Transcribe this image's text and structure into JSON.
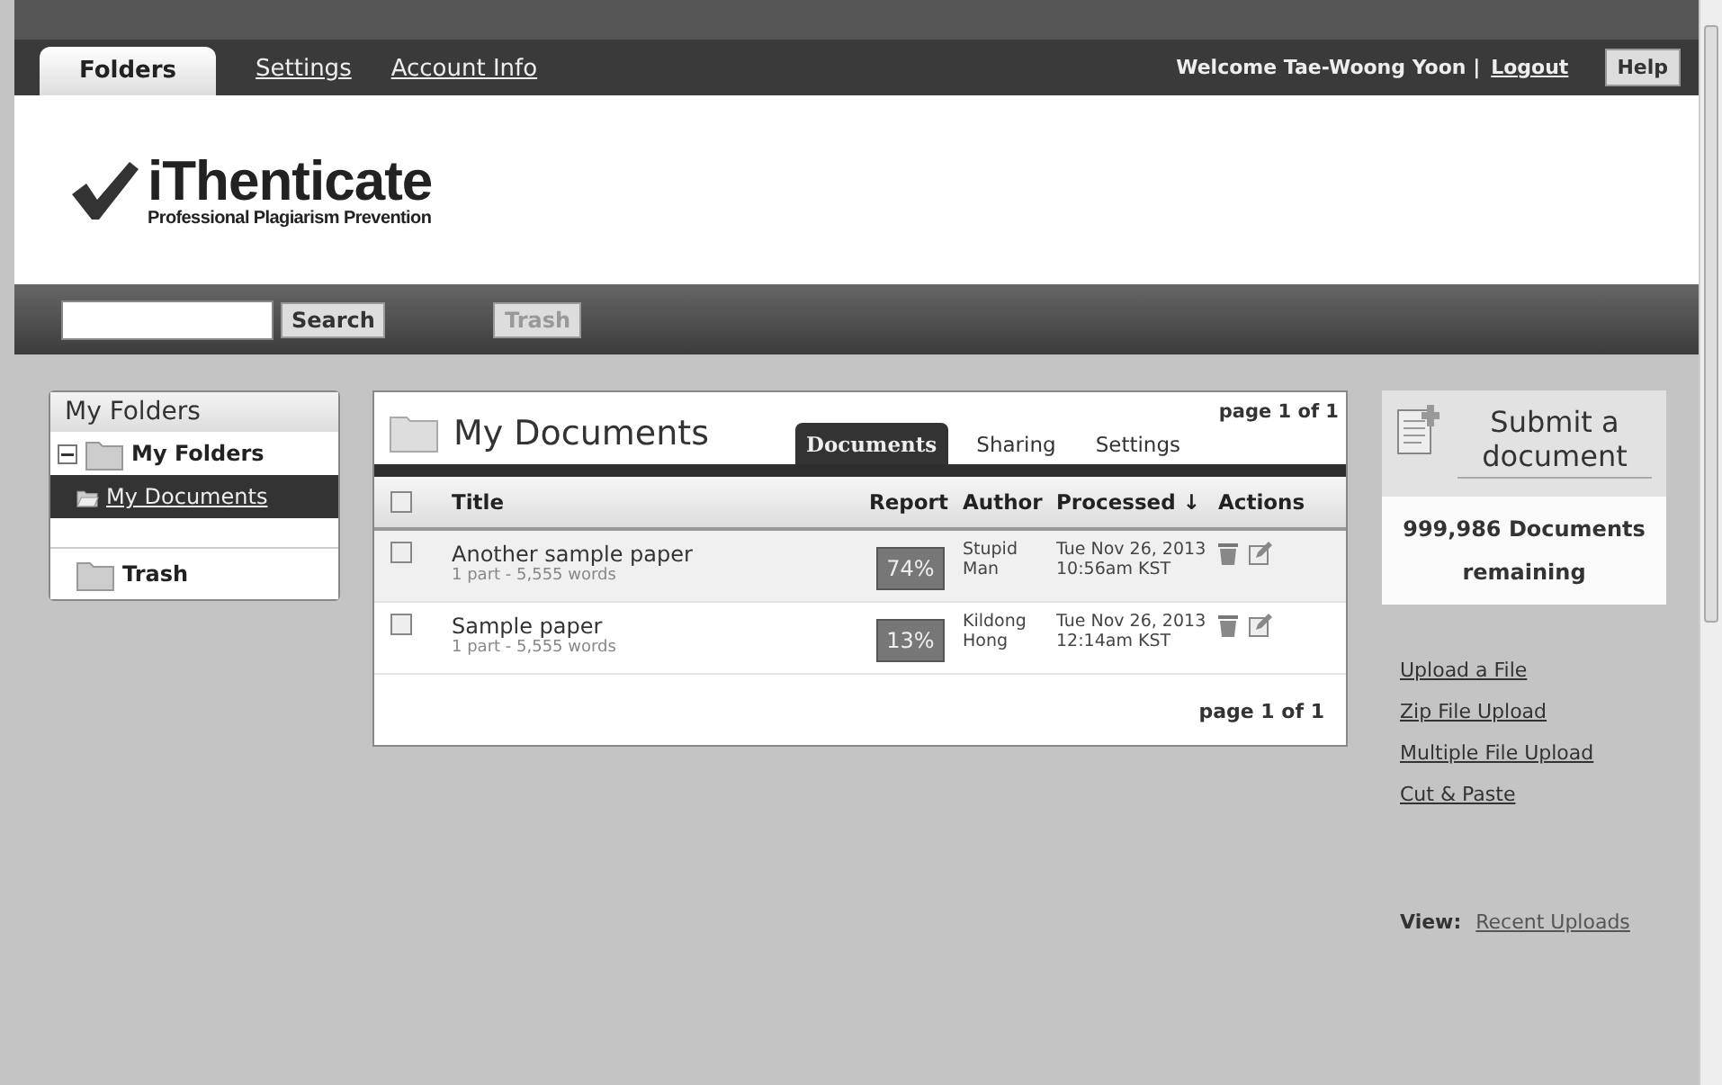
{
  "top_nav": {
    "tabs": [
      {
        "label": "Folders",
        "selected": true
      },
      {
        "label": "Settings",
        "selected": false
      },
      {
        "label": "Account Info",
        "selected": false
      }
    ],
    "welcome": "Welcome Tae-Woong Yoon |",
    "logout": "Logout",
    "help": "Help"
  },
  "logo": {
    "name": "iThenticate",
    "tagline": "Professional Plagiarism Prevention"
  },
  "toolbar": {
    "search_button": "Search",
    "trash_button": "Trash",
    "trash_disabled": true
  },
  "folders": {
    "title": "My Folders",
    "root": {
      "label": "My Folders",
      "expanded": true,
      "children": [
        {
          "label": "My Documents",
          "selected": true
        }
      ]
    },
    "trash": "Trash"
  },
  "documents": {
    "title": "My Documents",
    "page_top": "page 1 of 1",
    "page_bottom": "page 1 of 1",
    "tabs": [
      {
        "label": "Documents",
        "selected": true
      },
      {
        "label": "Sharing",
        "selected": false
      },
      {
        "label": "Settings",
        "selected": false
      }
    ],
    "select_all_checked": false,
    "columns": [
      "Title",
      "Report",
      "Author",
      "Processed ↓",
      "Actions"
    ],
    "rows": [
      {
        "title": "Another sample paper",
        "meta": "1 part - 5,555 words",
        "report": "74%",
        "author": "Stupid Man",
        "processed": "Tue Nov 26, 2013 10:56am KST",
        "checked": false
      },
      {
        "title": "Sample paper",
        "meta": "1 part - 5,555 words",
        "report": "13%",
        "author": "Kildong Hong",
        "processed": "Tue Nov 26, 2013 12:14am KST",
        "checked": false
      }
    ]
  },
  "submit": {
    "title": "Submit a document",
    "remaining": "999,986 Documents remaining",
    "links": [
      "Upload a File",
      "Zip File Upload",
      "Multiple File Upload",
      "Cut & Paste"
    ],
    "view_label": "View:",
    "view_link": "Recent Uploads"
  }
}
